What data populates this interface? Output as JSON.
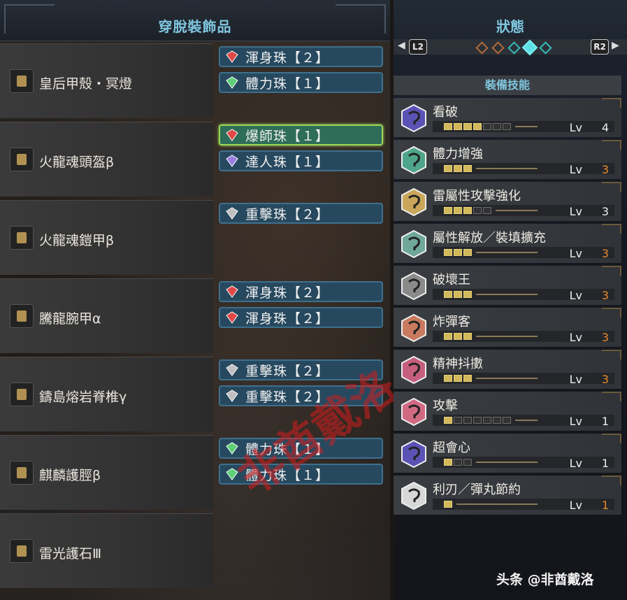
{
  "left_panel": {
    "title": "穿脫裝飾品",
    "equipment": [
      {
        "name": "皇后甲殼・冥燈",
        "icon": "charm-shaped-arm-icon",
        "slots": [
          {
            "label": "渾身珠【２】",
            "gem": "red",
            "selected": false
          },
          {
            "label": "體力珠【１】",
            "gem": "green",
            "selected": false
          }
        ]
      },
      {
        "name": "火龍魂頭盔β",
        "icon": "helmet-icon",
        "slots": [
          {
            "label": "爆師珠【１】",
            "gem": "red",
            "selected": true
          },
          {
            "label": "達人珠【１】",
            "gem": "purple",
            "selected": false
          }
        ]
      },
      {
        "name": "火龍魂鎧甲β",
        "icon": "chest-armor-icon",
        "slots": [
          {
            "label": "重擊珠【２】",
            "gem": "gray",
            "selected": false
          }
        ]
      },
      {
        "name": "騰龍腕甲α",
        "icon": "gauntlet-icon",
        "slots": [
          {
            "label": "渾身珠【２】",
            "gem": "red",
            "selected": false
          },
          {
            "label": "渾身珠【２】",
            "gem": "red",
            "selected": false
          }
        ]
      },
      {
        "name": "鑄島熔岩脊椎γ",
        "icon": "waist-armor-icon",
        "slots": [
          {
            "label": "重擊珠【２】",
            "gem": "gray",
            "selected": false
          },
          {
            "label": "重擊珠【２】",
            "gem": "gray",
            "selected": false
          }
        ]
      },
      {
        "name": "麒麟護脛β",
        "icon": "leg-armor-icon",
        "slots": [
          {
            "label": "體力珠【１】",
            "gem": "green",
            "selected": false
          },
          {
            "label": "體力珠【１】",
            "gem": "green",
            "selected": false
          }
        ]
      },
      {
        "name": "雷光護石Ⅲ",
        "icon": "charm-icon",
        "slots": []
      }
    ],
    "watermark": "非酋戴洛"
  },
  "right_panel": {
    "title": "狀態",
    "nav_left": "L2",
    "nav_right": "R2",
    "section_title": "裝備技能",
    "lv_label": "Lv",
    "skills": [
      {
        "name": "看破",
        "level": 4,
        "max": 7,
        "color": "#5b52b5",
        "maxed": false
      },
      {
        "name": "體力增強",
        "level": 3,
        "max": 3,
        "color": "#4fa58a",
        "maxed": true
      },
      {
        "name": "雷屬性攻擊強化",
        "level": 3,
        "max": 5,
        "color": "#c9a65a",
        "maxed": false
      },
      {
        "name": "屬性解放／裝填擴充",
        "level": 3,
        "max": 3,
        "color": "#6fa898",
        "maxed": true
      },
      {
        "name": "破壞王",
        "level": 3,
        "max": 3,
        "color": "#8a8a8a",
        "maxed": true
      },
      {
        "name": "炸彈客",
        "level": 3,
        "max": 3,
        "color": "#c97a5e",
        "maxed": true
      },
      {
        "name": "精神抖擻",
        "level": 3,
        "max": 3,
        "color": "#c65f7f",
        "maxed": true
      },
      {
        "name": "攻擊",
        "level": 1,
        "max": 7,
        "color": "#d06a82",
        "maxed": false
      },
      {
        "name": "超會心",
        "level": 1,
        "max": 3,
        "color": "#5b52b5",
        "maxed": false
      },
      {
        "name": "利刃／彈丸節約",
        "level": 1,
        "max": 1,
        "color": "#d8d8d8",
        "maxed": true
      }
    ]
  },
  "credit": "头条 @非酋戴洛"
}
